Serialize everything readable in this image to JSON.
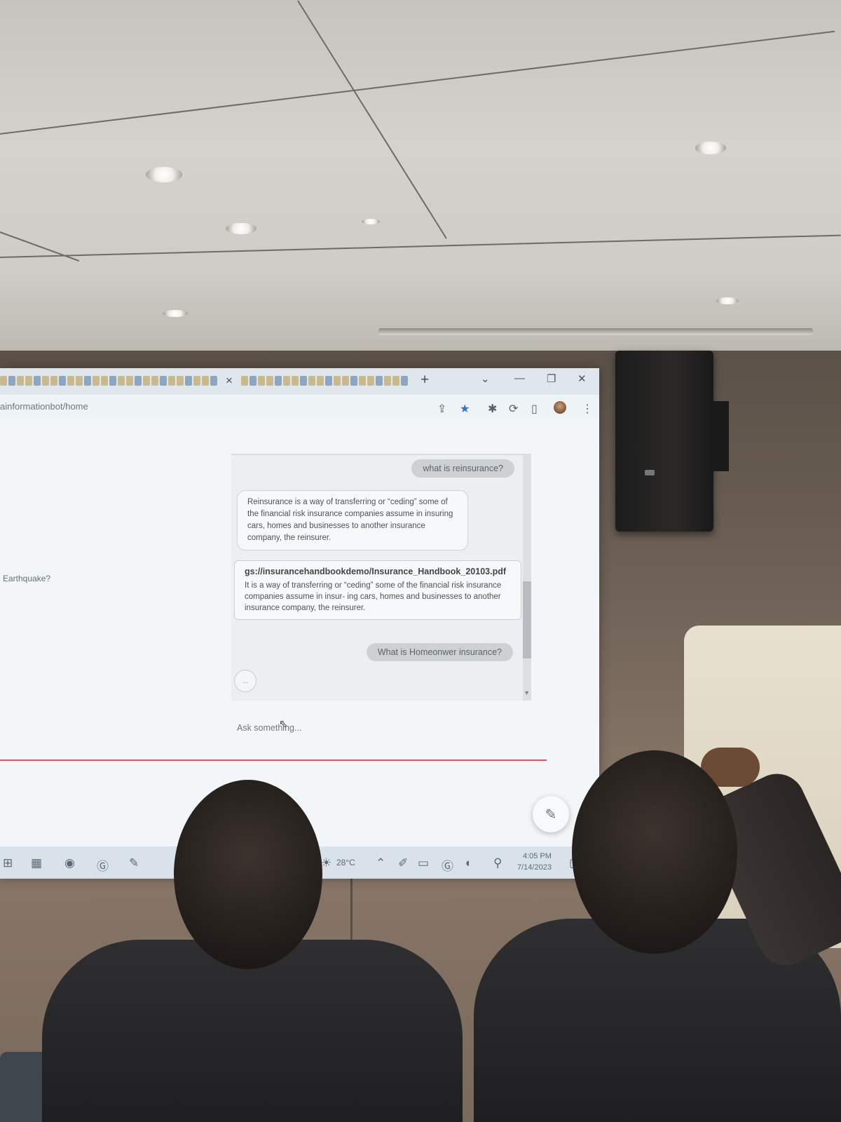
{
  "browser": {
    "url_fragment": "ainformationbot/home",
    "tab_close_glyph": "×",
    "new_tab_glyph": "+"
  },
  "sidebar": {
    "partial_question": "Earthquake?"
  },
  "chat": {
    "messages": [
      {
        "role": "user",
        "text": "what is reinsurance?"
      },
      {
        "role": "bot",
        "text": "Reinsurance is a way of transferring or “ceding” some of the financial risk insurance companies assume in insuring cars, homes and businesses to another insurance company, the reinsurer."
      },
      {
        "role": "source",
        "path": "gs://insurancehandbookdemo/Insurance_Handbook_20103.pdf",
        "text": "It is a way of transferring or “ceding” some of the financial risk insurance companies assume in insur- ing cars, homes and businesses to another insurance company, the reinsurer."
      },
      {
        "role": "user",
        "text": "What is Homeonwer insurance?"
      }
    ],
    "typing_indicator": "...",
    "input_placeholder": "Ask something..."
  },
  "taskbar": {
    "weather": "28°C",
    "time": "4:05 PM",
    "date": "7/14/2023"
  },
  "icons": [
    "share-icon",
    "star-icon",
    "extensions-icon",
    "sync-icon",
    "sidebar-icon",
    "profile-avatar",
    "kebab-menu-icon",
    "edit-pencil-icon"
  ],
  "colors": {
    "accent_line": "#d9565a",
    "bookmark_star": "#2f6fd6"
  }
}
